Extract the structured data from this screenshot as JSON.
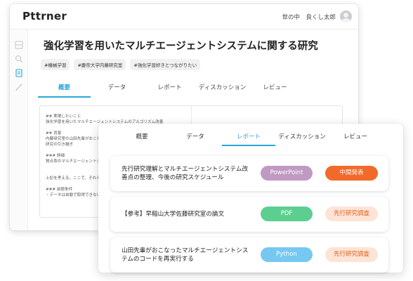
{
  "app": {
    "logo": "Pttrner",
    "user_name": "世の中　良くし太郎"
  },
  "page": {
    "title": "強化学習を用いたマルチエージェントシステムに関する研究",
    "tags": [
      "#機械学習",
      "#慶帝大学内藤研究室",
      "#強化学習好きとつながりたい"
    ]
  },
  "tabs": [
    "概要",
    "データ",
    "レポート",
    "ディスカッション",
    "レビュー"
  ],
  "back_active_tab": "概要",
  "front_active_tab": "レポート",
  "document_lines": [
    "## 実現したいこと",
    "強化学習を用いたマルチエージェントシステムのアルゴリズム改善",
    "",
    "## 背景",
    "内藤研究室の山田先輩がおこなった",
    "研究の引き継ぎ",
    "",
    "### 詳細",
    "質点系のマルチエージェントシステムの",
    "",
    "上記を考える。ここで、それぞれの",
    "",
    "### 前提条件",
    "・データは自動で取得できない"
  ],
  "reports": [
    {
      "title": "先行研究理解とマルチエージェントシステム改善点の整理、今後の研究スケジュール",
      "type": "PowerPoint",
      "status": "中間発表"
    },
    {
      "title": "【参考】早稲山大学佐藤研究室の論文",
      "type": "PDF",
      "status": "先行研究調査"
    },
    {
      "title": "山田先輩がおこなったマルチエージェントシステムのコードを再実行する",
      "type": "Python",
      "status": "先行研究調査"
    }
  ],
  "colors": {
    "accent": "#2aa6d8",
    "powerpoint": "#c09ac3",
    "pdf": "#5ccf90",
    "python": "#76c8f0",
    "status_strong_bg": "#f26a2a",
    "status_light_bg": "#fde4d6",
    "status_light_text": "#e0631f"
  }
}
